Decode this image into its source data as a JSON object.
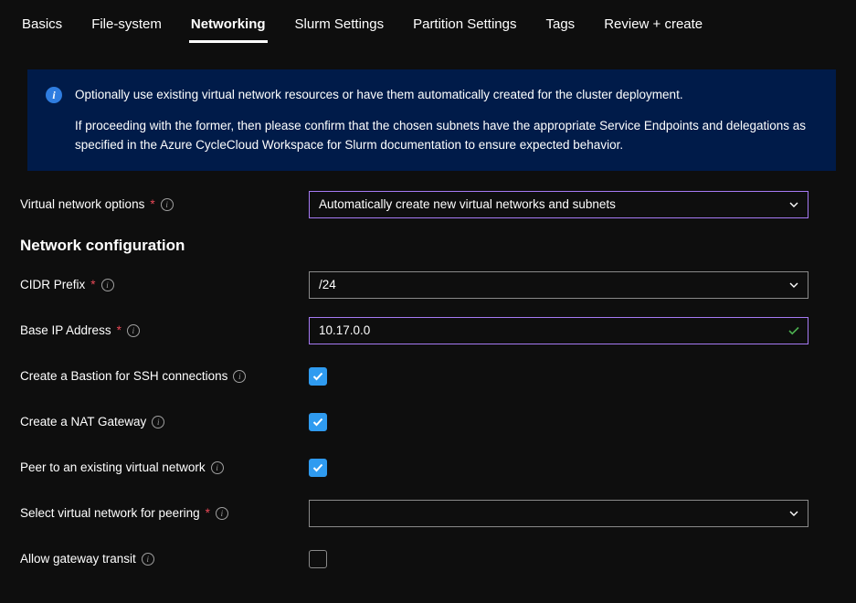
{
  "tabs": [
    {
      "label": "Basics"
    },
    {
      "label": "File-system"
    },
    {
      "label": "Networking"
    },
    {
      "label": "Slurm Settings"
    },
    {
      "label": "Partition Settings"
    },
    {
      "label": "Tags"
    },
    {
      "label": "Review + create"
    }
  ],
  "active_tab_index": 2,
  "banner": {
    "p1": "Optionally use existing virtual network resources or have them automatically created for the cluster deployment.",
    "p2": "If proceeding with the former, then please confirm that the chosen subnets have the appropriate Service Endpoints and delegations as specified in the Azure CycleCloud Workspace for Slurm documentation to ensure expected behavior."
  },
  "fields": {
    "vnet_options": {
      "label": "Virtual network options",
      "required": true,
      "value": "Automatically create new virtual networks and subnets"
    },
    "section_netconf": "Network configuration",
    "cidr": {
      "label": "CIDR Prefix",
      "required": true,
      "value": "/24"
    },
    "base_ip": {
      "label": "Base IP Address",
      "required": true,
      "value": "10.17.0.0",
      "valid": true
    },
    "bastion": {
      "label": "Create a Bastion for SSH connections",
      "checked": true
    },
    "nat": {
      "label": "Create a NAT Gateway",
      "checked": true
    },
    "peer": {
      "label": "Peer to an existing virtual network",
      "checked": true
    },
    "peer_select": {
      "label": "Select virtual network for peering",
      "required": true,
      "value": ""
    },
    "gw_transit": {
      "label": "Allow gateway transit",
      "checked": false
    }
  }
}
